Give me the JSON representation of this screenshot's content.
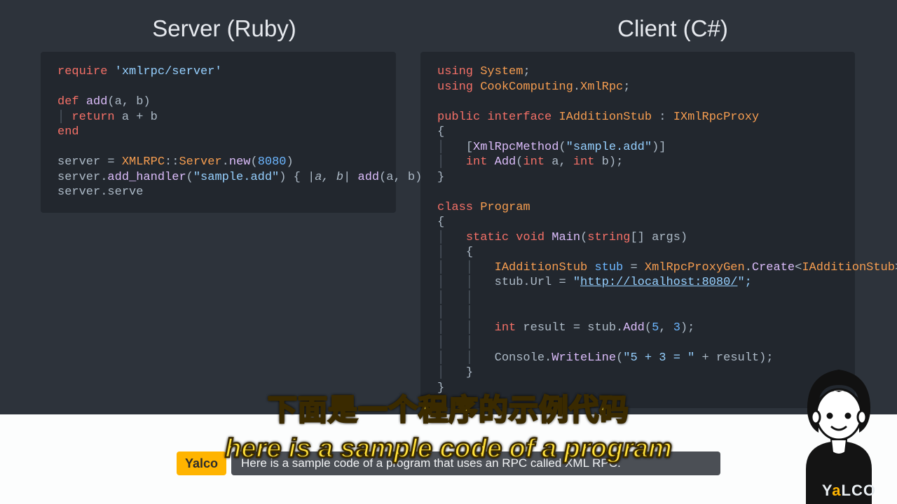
{
  "titles": {
    "left": "Server (Ruby)",
    "right": "Client (C#)"
  },
  "code": {
    "ruby": {
      "l1_require": "require",
      "l1_str": "'xmlrpc/server'",
      "l3_def": "def",
      "l3_name": "add",
      "l3_params": "(a, b)",
      "l4_return": "return",
      "l4_expr": "a + b",
      "l5_end": "end",
      "l7_a": "server = ",
      "l7_ns": "XMLRPC",
      "l7_col": "::",
      "l7_srv": "Server",
      "l7_dot": ".",
      "l7_new": "new",
      "l7_paren": "(",
      "l7_num": "8080",
      "l7_paren2": ")",
      "l8_a": "server.",
      "l8_h": "add_handler",
      "l8_paren": "(",
      "l8_str": "\"sample.add\"",
      "l8_paren2": ") { |",
      "l8_ab": "a, b",
      "l8_mid": "| ",
      "l8_add": "add",
      "l8_call": "(a, b) }",
      "l9": "server.serve"
    },
    "csharp": {
      "l1_using": "using",
      "l1_sys": "System",
      "l1_sc": ";",
      "l2_using": "using",
      "l2_cc": "CookComputing",
      "l2_dot": ".",
      "l2_xr": "XmlRpc",
      "l2_sc": ";",
      "l4_pub": "public",
      "l4_if": "interface",
      "l4_name": "IAdditionStub",
      "l4_colon": " : ",
      "l4_base": "IXmlRpcProxy",
      "l5_ob": "{",
      "l6_attr_open": "[",
      "l6_attr": "XmlRpcMethod",
      "l6_attr_p": "(",
      "l6_str": "\"sample.add\"",
      "l6_attr_close": ")]",
      "l7_int": "int",
      "l7_add": "Add",
      "l7_p": "(",
      "l7_int2": "int",
      "l7_a": " a, ",
      "l7_int3": "int",
      "l7_b": " b);",
      "l8_cb": "}",
      "l10_class": "class",
      "l10_name": "Program",
      "l11_ob": "{",
      "l12_static": "static",
      "l12_void": "void",
      "l12_main": "Main",
      "l12_p": "(",
      "l12_str": "string",
      "l12_arr": "[] args)",
      "l13_ob": "{",
      "l14_t": "IAdditionStub",
      "l14_v": "stub",
      "l14_eq": " = ",
      "l14_c1": "XmlRpcProxyGen",
      "l14_dot": ".",
      "l14_create": "Create",
      "l14_lt": "<",
      "l14_t2": "IAdditionStub",
      "l14_gt": ">();",
      "l15_a": "stub.Url = ",
      "l15_q": "\"",
      "l15_url": "http://localhost:8080/",
      "l15_q2": "\";",
      "l18_int": "int",
      "l18_r": " result = stub.",
      "l18_add": "Add",
      "l18_p": "(",
      "l18_5": "5",
      "l18_c": ", ",
      "l18_3": "3",
      "l18_close": ");",
      "l20_a": "Console.",
      "l20_wl": "WriteLine",
      "l20_p": "(",
      "l20_str": "\"5 + 3 = \"",
      "l20_plus": " + result);",
      "l21_cb": "}",
      "l22_cb": "}"
    }
  },
  "caption": {
    "chinese": "下面是一个程序的示例代码",
    "english": "here is a sample code of a program",
    "speaker": "Yalco",
    "subtitle_bg": "Here is a sample code of a program that uses an RPC called XML RPC."
  },
  "logo": {
    "text_pre": "Y",
    "text_a": "a",
    "text_post": "LCO"
  }
}
